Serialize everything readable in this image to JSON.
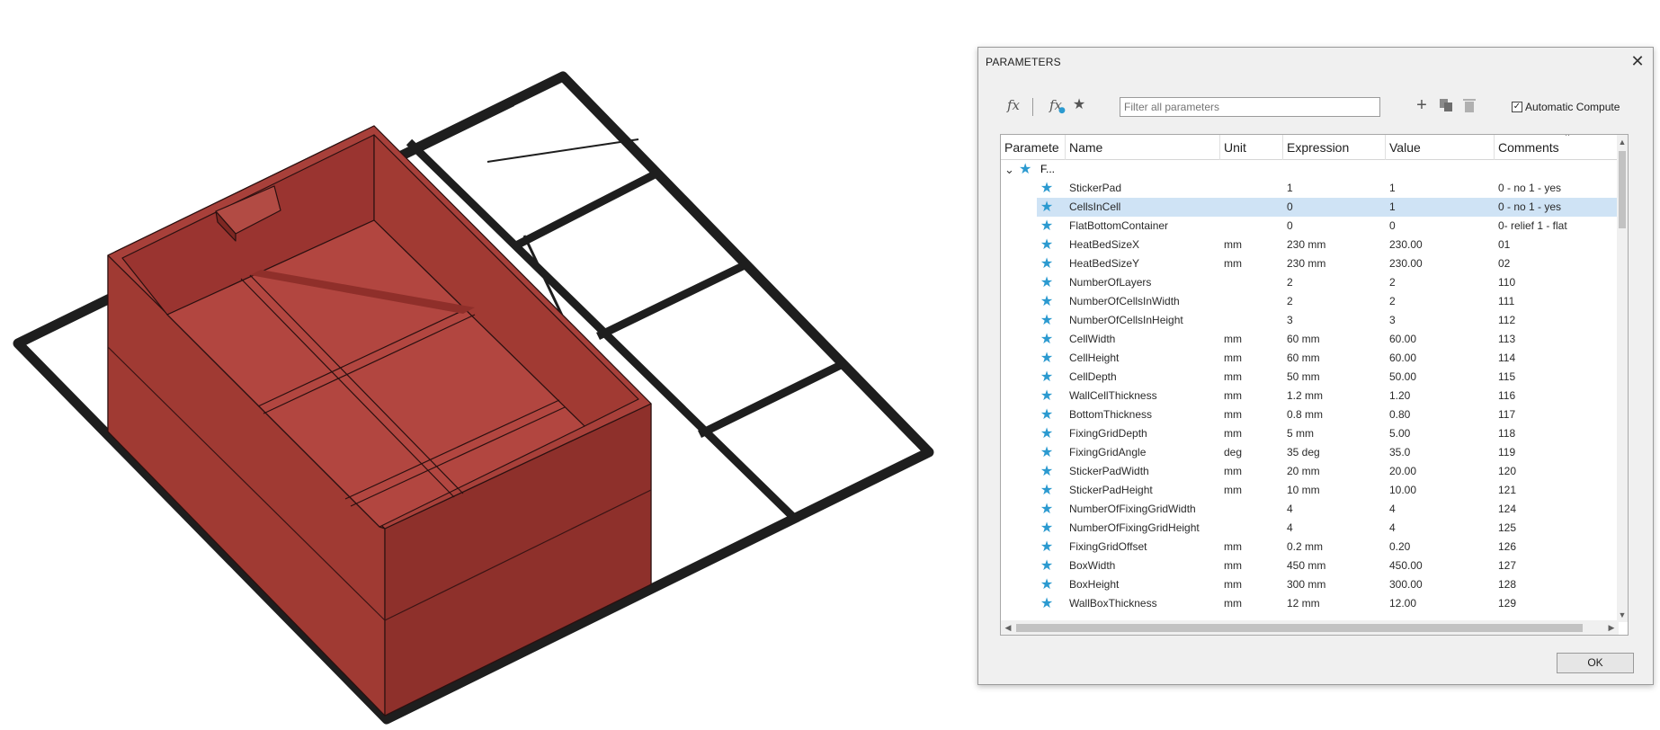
{
  "dialog": {
    "title": "PARAMETERS",
    "close_icon": "close-icon",
    "ok_label": "OK"
  },
  "toolbar": {
    "fx_icon": "fx",
    "fx_user_icon": "fx",
    "favorites_icon": "★",
    "filter_placeholder": "Filter all parameters",
    "add_icon": "+",
    "copy_icon": "copy-icon",
    "delete_icon": "trash-icon",
    "auto_compute_label": "Automatic Compute",
    "auto_compute_checked": "✓"
  },
  "table": {
    "columns": [
      "Paramete",
      "Name",
      "Unit",
      "Expression",
      "Value",
      "Comments"
    ],
    "group": {
      "expand_icon": "⌄",
      "star": "★",
      "label": "F..."
    },
    "rows": [
      {
        "name": "StickerPad",
        "unit": "",
        "expression": "1",
        "value": "1",
        "comment": "0 - no 1 - yes"
      },
      {
        "name": "CellsInCell",
        "unit": "",
        "expression": "0",
        "value": "1",
        "comment": "0 - no 1 - yes"
      },
      {
        "name": "FlatBottomContainer",
        "unit": "",
        "expression": "0",
        "value": "0",
        "comment": "0- relief 1 - flat"
      },
      {
        "name": "HeatBedSizeX",
        "unit": "mm",
        "expression": "230 mm",
        "value": "230.00",
        "comment": "01"
      },
      {
        "name": "HeatBedSizeY",
        "unit": "mm",
        "expression": "230 mm",
        "value": "230.00",
        "comment": "02"
      },
      {
        "name": "NumberOfLayers",
        "unit": "",
        "expression": "2",
        "value": "2",
        "comment": "110"
      },
      {
        "name": "NumberOfCellsInWidth",
        "unit": "",
        "expression": "2",
        "value": "2",
        "comment": "111"
      },
      {
        "name": "NumberOfCellsInHeight",
        "unit": "",
        "expression": "3",
        "value": "3",
        "comment": "112"
      },
      {
        "name": "CellWidth",
        "unit": "mm",
        "expression": "60 mm",
        "value": "60.00",
        "comment": "113"
      },
      {
        "name": "CellHeight",
        "unit": "mm",
        "expression": "60 mm",
        "value": "60.00",
        "comment": "114"
      },
      {
        "name": "CellDepth",
        "unit": "mm",
        "expression": "50 mm",
        "value": "50.00",
        "comment": "115"
      },
      {
        "name": "WallCellThickness",
        "unit": "mm",
        "expression": "1.2 mm",
        "value": "1.20",
        "comment": "116"
      },
      {
        "name": "BottomThickness",
        "unit": "mm",
        "expression": "0.8 mm",
        "value": "0.80",
        "comment": "117"
      },
      {
        "name": "FixingGridDepth",
        "unit": "mm",
        "expression": "5 mm",
        "value": "5.00",
        "comment": "118"
      },
      {
        "name": "FixingGridAngle",
        "unit": "deg",
        "expression": "35 deg",
        "value": "35.0",
        "comment": "119"
      },
      {
        "name": "StickerPadWidth",
        "unit": "mm",
        "expression": "20 mm",
        "value": "20.00",
        "comment": "120"
      },
      {
        "name": "StickerPadHeight",
        "unit": "mm",
        "expression": "10 mm",
        "value": "10.00",
        "comment": "121"
      },
      {
        "name": "NumberOfFixingGridWidth",
        "unit": "",
        "expression": "4",
        "value": "4",
        "comment": "124"
      },
      {
        "name": "NumberOfFixingGridHeight",
        "unit": "",
        "expression": "4",
        "value": "4",
        "comment": "125"
      },
      {
        "name": "FixingGridOffset",
        "unit": "mm",
        "expression": "0.2 mm",
        "value": "0.20",
        "comment": "126"
      },
      {
        "name": "BoxWidth",
        "unit": "mm",
        "expression": "450 mm",
        "value": "450.00",
        "comment": "127"
      },
      {
        "name": "BoxHeight",
        "unit": "mm",
        "expression": "300 mm",
        "value": "300.00",
        "comment": "128"
      },
      {
        "name": "WallBoxThickness",
        "unit": "mm",
        "expression": "12 mm",
        "value": "12.00",
        "comment": "129"
      }
    ],
    "selected_row": 1
  },
  "colors": {
    "accent_star": "#2b9ad0",
    "selection": "#cfe3f5",
    "box_red": "#a83b33",
    "grid_black": "#1e1e1e"
  }
}
